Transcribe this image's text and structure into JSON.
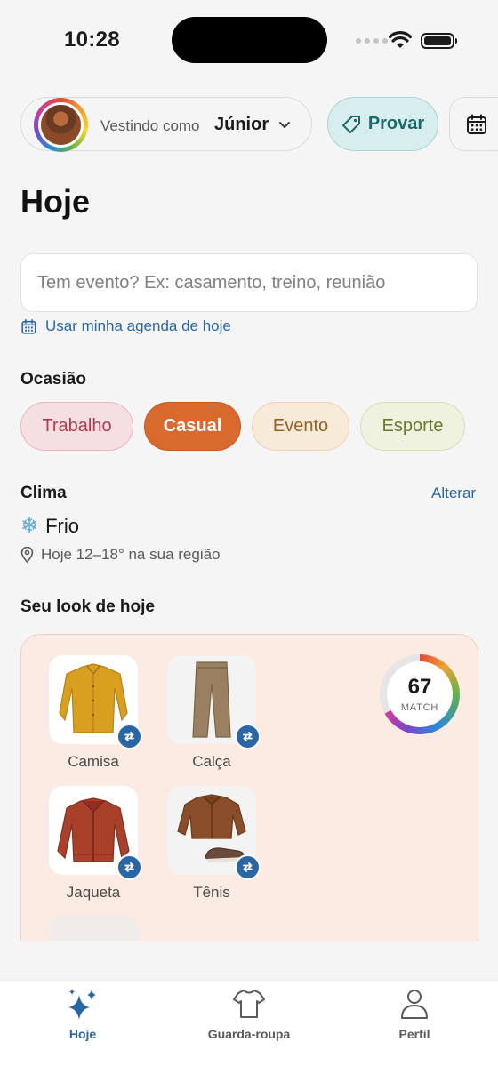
{
  "status_bar": {
    "time": "10:28"
  },
  "header": {
    "wearing_prefix": "Vestindo como",
    "user_name": "Júnior",
    "try_on_label": "Provar"
  },
  "page": {
    "title": "Hoje"
  },
  "event": {
    "placeholder": "Tem evento? Ex: casamento, treino, reunião",
    "agenda_link": "Usar minha agenda de hoje"
  },
  "occasion": {
    "label": "Ocasião",
    "options": [
      "Trabalho",
      "Casual",
      "Evento",
      "Esporte"
    ],
    "selected": "Casual"
  },
  "climate": {
    "label": "Clima",
    "change_label": "Alterar",
    "condition": "Frio",
    "icon": "snowflake-icon",
    "detail": "Hoje 12–18° na sua região"
  },
  "look": {
    "title": "Seu look de hoje",
    "items": [
      {
        "label": "Camisa"
      },
      {
        "label": "Calça"
      },
      {
        "label": "Jaqueta"
      },
      {
        "label": "Tênis"
      }
    ],
    "match_score": "67",
    "match_value": 67,
    "match_label": "MATCH"
  },
  "tabs": [
    {
      "label": "Hoje",
      "icon": "sparkles-icon",
      "active": true
    },
    {
      "label": "Guarda-roupa",
      "icon": "tshirt-icon",
      "active": false
    },
    {
      "label": "Perfil",
      "icon": "person-icon",
      "active": false
    }
  ],
  "colors": {
    "accent_blue": "#2a66a6",
    "casual_orange": "#d96a2e",
    "teal": "#1a6a6a"
  }
}
